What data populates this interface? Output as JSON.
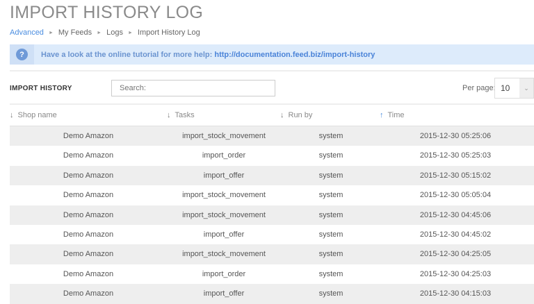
{
  "title": "IMPORT HISTORY LOG",
  "breadcrumb": [
    "Advanced",
    "My Feeds",
    "Logs",
    "Import History Log"
  ],
  "info": {
    "text": "Have a look at the online tutorial for more help:",
    "link": "http://documentation.feed.biz/import-history"
  },
  "section_title": "IMPORT HISTORY",
  "search": {
    "placeholder": "Search:"
  },
  "per_page": {
    "label": "Per page:",
    "value": "10"
  },
  "columns": [
    "Shop name",
    "Tasks",
    "Run by",
    "Time"
  ],
  "rows": [
    [
      "Demo Amazon",
      "import_stock_movement",
      "system",
      "2015-12-30 05:25:06"
    ],
    [
      "Demo Amazon",
      "import_order",
      "system",
      "2015-12-30 05:25:03"
    ],
    [
      "Demo Amazon",
      "import_offer",
      "system",
      "2015-12-30 05:15:02"
    ],
    [
      "Demo Amazon",
      "import_stock_movement",
      "system",
      "2015-12-30 05:05:04"
    ],
    [
      "Demo Amazon",
      "import_stock_movement",
      "system",
      "2015-12-30 04:45:06"
    ],
    [
      "Demo Amazon",
      "import_offer",
      "system",
      "2015-12-30 04:45:02"
    ],
    [
      "Demo Amazon",
      "import_stock_movement",
      "system",
      "2015-12-30 04:25:05"
    ],
    [
      "Demo Amazon",
      "import_order",
      "system",
      "2015-12-30 04:25:03"
    ],
    [
      "Demo Amazon",
      "import_offer",
      "system",
      "2015-12-30 04:15:03"
    ]
  ]
}
